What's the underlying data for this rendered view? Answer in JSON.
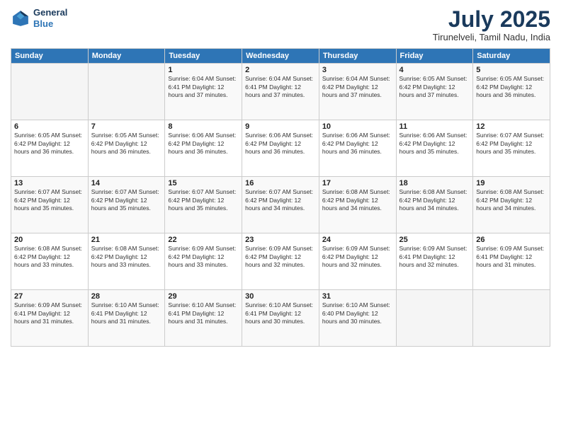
{
  "header": {
    "logo_line1": "General",
    "logo_line2": "Blue",
    "month": "July 2025",
    "location": "Tirunelveli, Tamil Nadu, India"
  },
  "weekdays": [
    "Sunday",
    "Monday",
    "Tuesday",
    "Wednesday",
    "Thursday",
    "Friday",
    "Saturday"
  ],
  "weeks": [
    [
      {
        "day": "",
        "info": ""
      },
      {
        "day": "",
        "info": ""
      },
      {
        "day": "1",
        "info": "Sunrise: 6:04 AM\nSunset: 6:41 PM\nDaylight: 12 hours\nand 37 minutes."
      },
      {
        "day": "2",
        "info": "Sunrise: 6:04 AM\nSunset: 6:41 PM\nDaylight: 12 hours\nand 37 minutes."
      },
      {
        "day": "3",
        "info": "Sunrise: 6:04 AM\nSunset: 6:42 PM\nDaylight: 12 hours\nand 37 minutes."
      },
      {
        "day": "4",
        "info": "Sunrise: 6:05 AM\nSunset: 6:42 PM\nDaylight: 12 hours\nand 37 minutes."
      },
      {
        "day": "5",
        "info": "Sunrise: 6:05 AM\nSunset: 6:42 PM\nDaylight: 12 hours\nand 36 minutes."
      }
    ],
    [
      {
        "day": "6",
        "info": "Sunrise: 6:05 AM\nSunset: 6:42 PM\nDaylight: 12 hours\nand 36 minutes."
      },
      {
        "day": "7",
        "info": "Sunrise: 6:05 AM\nSunset: 6:42 PM\nDaylight: 12 hours\nand 36 minutes."
      },
      {
        "day": "8",
        "info": "Sunrise: 6:06 AM\nSunset: 6:42 PM\nDaylight: 12 hours\nand 36 minutes."
      },
      {
        "day": "9",
        "info": "Sunrise: 6:06 AM\nSunset: 6:42 PM\nDaylight: 12 hours\nand 36 minutes."
      },
      {
        "day": "10",
        "info": "Sunrise: 6:06 AM\nSunset: 6:42 PM\nDaylight: 12 hours\nand 36 minutes."
      },
      {
        "day": "11",
        "info": "Sunrise: 6:06 AM\nSunset: 6:42 PM\nDaylight: 12 hours\nand 35 minutes."
      },
      {
        "day": "12",
        "info": "Sunrise: 6:07 AM\nSunset: 6:42 PM\nDaylight: 12 hours\nand 35 minutes."
      }
    ],
    [
      {
        "day": "13",
        "info": "Sunrise: 6:07 AM\nSunset: 6:42 PM\nDaylight: 12 hours\nand 35 minutes."
      },
      {
        "day": "14",
        "info": "Sunrise: 6:07 AM\nSunset: 6:42 PM\nDaylight: 12 hours\nand 35 minutes."
      },
      {
        "day": "15",
        "info": "Sunrise: 6:07 AM\nSunset: 6:42 PM\nDaylight: 12 hours\nand 35 minutes."
      },
      {
        "day": "16",
        "info": "Sunrise: 6:07 AM\nSunset: 6:42 PM\nDaylight: 12 hours\nand 34 minutes."
      },
      {
        "day": "17",
        "info": "Sunrise: 6:08 AM\nSunset: 6:42 PM\nDaylight: 12 hours\nand 34 minutes."
      },
      {
        "day": "18",
        "info": "Sunrise: 6:08 AM\nSunset: 6:42 PM\nDaylight: 12 hours\nand 34 minutes."
      },
      {
        "day": "19",
        "info": "Sunrise: 6:08 AM\nSunset: 6:42 PM\nDaylight: 12 hours\nand 34 minutes."
      }
    ],
    [
      {
        "day": "20",
        "info": "Sunrise: 6:08 AM\nSunset: 6:42 PM\nDaylight: 12 hours\nand 33 minutes."
      },
      {
        "day": "21",
        "info": "Sunrise: 6:08 AM\nSunset: 6:42 PM\nDaylight: 12 hours\nand 33 minutes."
      },
      {
        "day": "22",
        "info": "Sunrise: 6:09 AM\nSunset: 6:42 PM\nDaylight: 12 hours\nand 33 minutes."
      },
      {
        "day": "23",
        "info": "Sunrise: 6:09 AM\nSunset: 6:42 PM\nDaylight: 12 hours\nand 32 minutes."
      },
      {
        "day": "24",
        "info": "Sunrise: 6:09 AM\nSunset: 6:42 PM\nDaylight: 12 hours\nand 32 minutes."
      },
      {
        "day": "25",
        "info": "Sunrise: 6:09 AM\nSunset: 6:41 PM\nDaylight: 12 hours\nand 32 minutes."
      },
      {
        "day": "26",
        "info": "Sunrise: 6:09 AM\nSunset: 6:41 PM\nDaylight: 12 hours\nand 31 minutes."
      }
    ],
    [
      {
        "day": "27",
        "info": "Sunrise: 6:09 AM\nSunset: 6:41 PM\nDaylight: 12 hours\nand 31 minutes."
      },
      {
        "day": "28",
        "info": "Sunrise: 6:10 AM\nSunset: 6:41 PM\nDaylight: 12 hours\nand 31 minutes."
      },
      {
        "day": "29",
        "info": "Sunrise: 6:10 AM\nSunset: 6:41 PM\nDaylight: 12 hours\nand 31 minutes."
      },
      {
        "day": "30",
        "info": "Sunrise: 6:10 AM\nSunset: 6:41 PM\nDaylight: 12 hours\nand 30 minutes."
      },
      {
        "day": "31",
        "info": "Sunrise: 6:10 AM\nSunset: 6:40 PM\nDaylight: 12 hours\nand 30 minutes."
      },
      {
        "day": "",
        "info": ""
      },
      {
        "day": "",
        "info": ""
      }
    ]
  ]
}
